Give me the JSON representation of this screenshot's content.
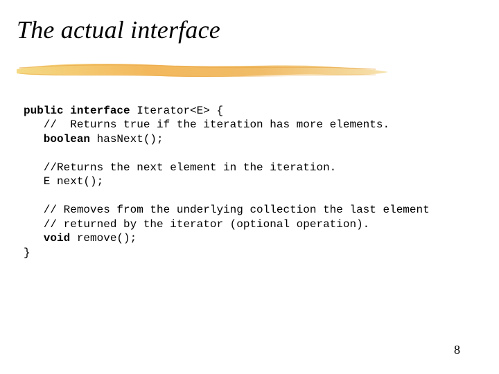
{
  "title": "The actual interface",
  "code": {
    "kw_public_interface": "public interface",
    "sig_iterator": " Iterator<E> {",
    "comment_hasnext": "   //  Returns true if the iteration has more elements.",
    "kw_boolean": "   boolean",
    "sig_hasnext": " hasNext();",
    "blank": "",
    "comment_next": "   //Returns the next element in the iteration.",
    "sig_next": "   E next();",
    "comment_remove1": "   // Removes from the underlying collection the last element",
    "comment_remove2": "   // returned by the iterator (optional operation).",
    "kw_void": "   void",
    "sig_remove": " remove();",
    "close_brace": "}"
  },
  "page_number": "8"
}
